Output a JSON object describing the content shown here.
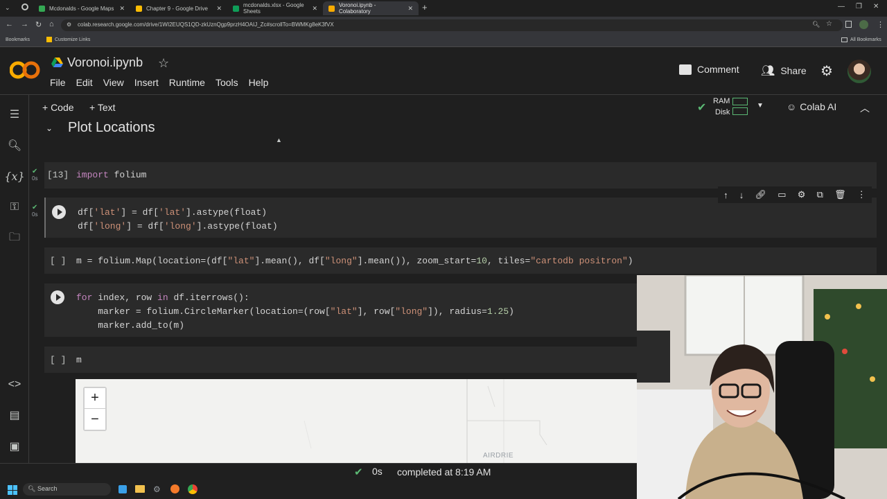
{
  "browser": {
    "tabs": [
      {
        "label": "Mcdonalds - Google Maps",
        "color": "#34a853"
      },
      {
        "label": "Chapter 9 - Google Drive",
        "color": "#fbbc04"
      },
      {
        "label": "mcdonalds.xlsx - Google Sheets",
        "color": "#0f9d58"
      },
      {
        "label": "Voronoi.ipynb - Colaboratory",
        "color": "#f9ab00"
      }
    ],
    "new_tab": "+",
    "url": "colab.research.google.com/drive/1WI2EUQS1QD-zkUznQgp9przH4OAIJ_Zc#scrollTo=BWMKg8eK3fVX",
    "bookmarks": [
      "Bookmarks",
      "Customize Links"
    ],
    "all_bookmarks": "All Bookmarks"
  },
  "colab": {
    "logo": "CO",
    "notebook_title": "Voronoi.ipynb",
    "menu": [
      "File",
      "Edit",
      "View",
      "Insert",
      "Runtime",
      "Tools",
      "Help"
    ],
    "comment_label": "Comment",
    "share_label": "Share",
    "add_code": "+ Code",
    "add_text": "+ Text",
    "ram_label": "RAM",
    "disk_label": "Disk",
    "colab_ai": "Colab AI"
  },
  "section": {
    "heading": "Plot Locations"
  },
  "cells": {
    "c1": {
      "count": "[13]",
      "status": "0s"
    },
    "c2": {
      "status": "0s"
    },
    "c3": {
      "count": "[ ]"
    },
    "c5": {
      "count": "[ ]",
      "code": "m"
    }
  },
  "map": {
    "zoom_in": "+",
    "zoom_out": "−",
    "place": "AIRDRIE"
  },
  "status_bar": {
    "duration": "0s",
    "completed": "completed at 8:19 AM"
  },
  "taskbar": {
    "search": "Search"
  },
  "colors": {
    "accent_orange": "#f9ab00",
    "check_green": "#5bb974"
  }
}
